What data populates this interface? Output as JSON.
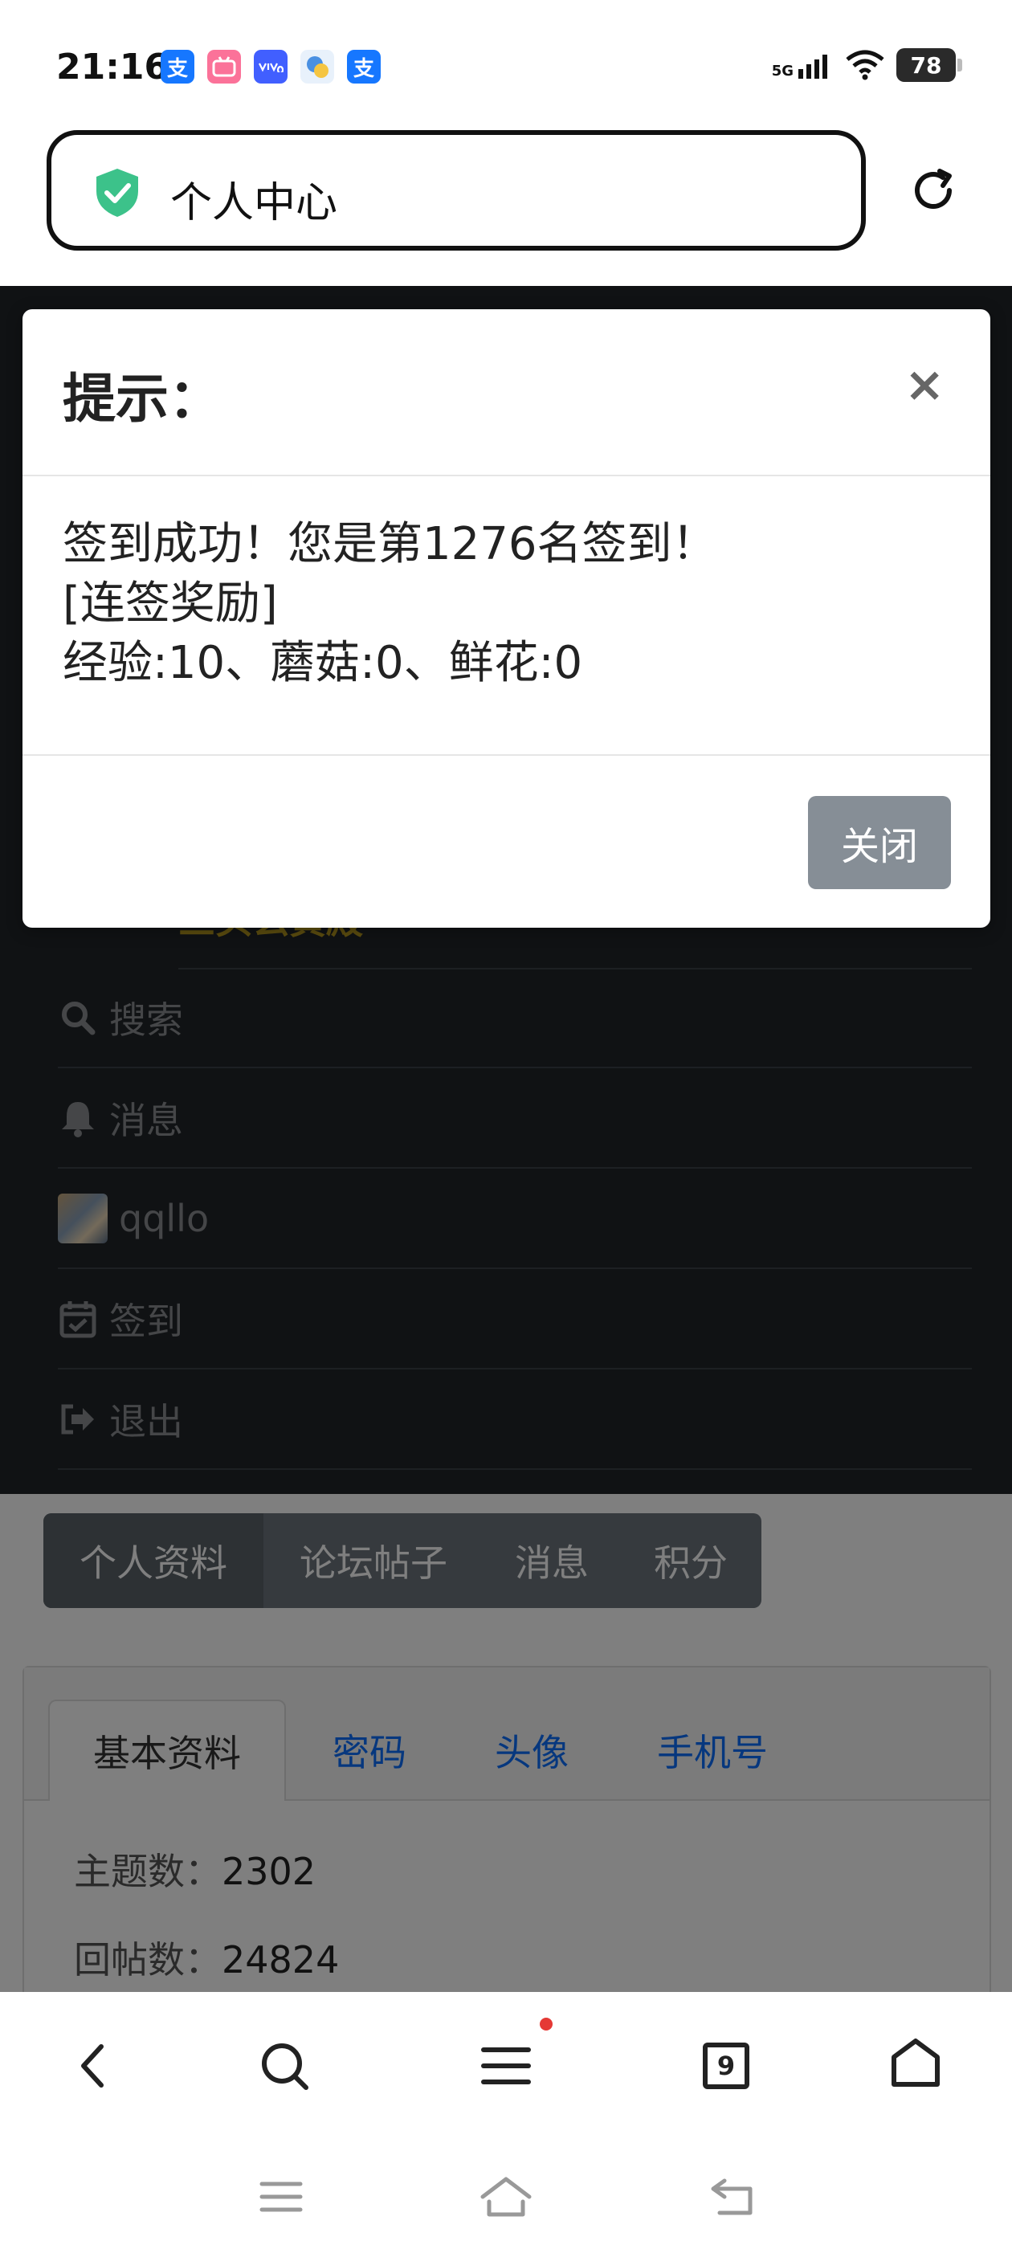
{
  "status_bar": {
    "time": "21:16",
    "network": "5G",
    "battery": "78",
    "notifications": [
      {
        "name": "alipay-icon",
        "glyph": "支",
        "color": "#1677ff"
      },
      {
        "name": "bilibili-icon",
        "glyph": "",
        "color": "#fb7299"
      },
      {
        "name": "vivo-icon",
        "glyph": "",
        "color": "#415fff"
      },
      {
        "name": "app-icon",
        "glyph": "",
        "color": "#4a90e2"
      },
      {
        "name": "alipay-icon",
        "glyph": "支",
        "color": "#1677ff"
      }
    ]
  },
  "address_bar": {
    "title": "个人中心"
  },
  "nav_menu": {
    "title": "三头玄黄殿",
    "items": [
      {
        "label": "搜索",
        "icon": "search-icon"
      },
      {
        "label": "消息",
        "icon": "bell-icon"
      },
      {
        "label": "qqllo",
        "icon": "avatar"
      },
      {
        "label": "签到",
        "icon": "calendar-check-icon"
      },
      {
        "label": "退出",
        "icon": "sign-out-icon"
      }
    ]
  },
  "pill_tabs": [
    "个人资料",
    "论坛帖子",
    "消息",
    "积分"
  ],
  "card_tabs": [
    "基本资料",
    "密码",
    "头像",
    "手机号"
  ],
  "stats": [
    {
      "label": "主题数：",
      "value": "2302"
    },
    {
      "label": "回帖数：",
      "value": "24824"
    }
  ],
  "modal": {
    "title": "提示：",
    "close_glyph": "×",
    "line1": "签到成功！您是第1276名签到！",
    "line2": "[连签奖励]",
    "line3": "经验:10、蘑菇:0、鲜花:0",
    "button": "关闭"
  },
  "toolbar": {
    "tab_count": "9"
  },
  "colors": {
    "nav_bg": "#212529",
    "nav_brand": "#b89b1f",
    "shield": "#3cc28a",
    "modal_button": "#868e96"
  }
}
